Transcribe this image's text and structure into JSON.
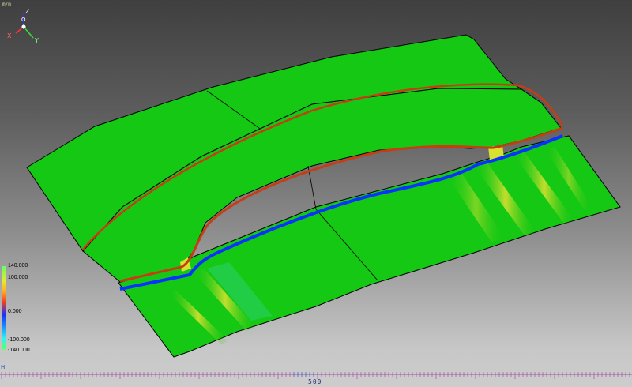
{
  "viewport": {
    "corner_label": "m/m",
    "triad": {
      "z": "Z",
      "x": "X",
      "y": "Y",
      "origin": "O"
    },
    "colors": {
      "surface": "#14c814",
      "edge": "#000000",
      "bead_red": "#c83c14",
      "bead_blue": "#0a32ff",
      "hotspot": "#d8e030",
      "highlight_cyan": "#38d8a0"
    }
  },
  "legend": {
    "max": "140.000",
    "p100": "100.000",
    "zero": "0.000",
    "m100": "-100.000",
    "min": "-140.000"
  },
  "ruler": {
    "h_mark": "H",
    "label": "500"
  }
}
